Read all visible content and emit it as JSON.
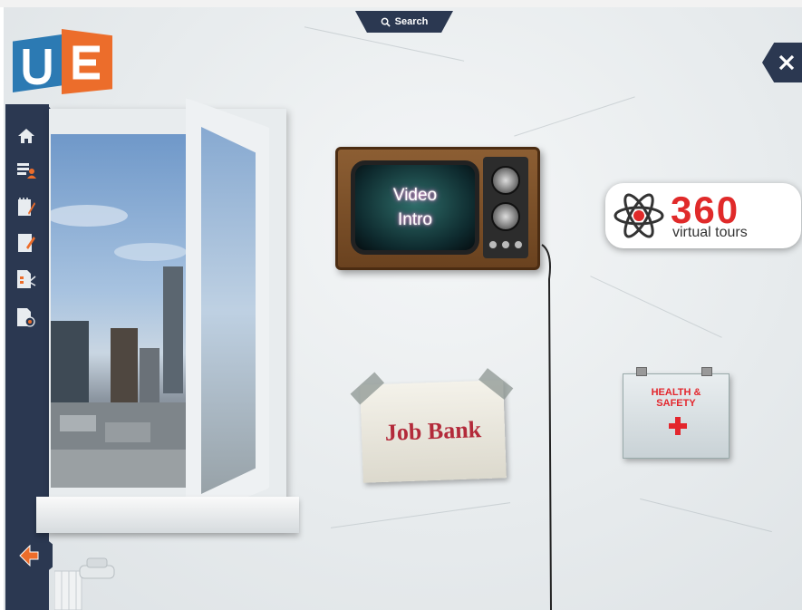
{
  "search": {
    "label": "Search",
    "icon": "search-icon"
  },
  "logo": {
    "text": "UE",
    "colors": {
      "u": "#2c7ab3",
      "e": "#ec6d2b"
    }
  },
  "sidebar": {
    "items": [
      {
        "name": "home",
        "icon": "home-icon"
      },
      {
        "name": "profile-list",
        "icon": "user-list-icon"
      },
      {
        "name": "notes",
        "icon": "notepad-pencil-icon"
      },
      {
        "name": "edit",
        "icon": "document-edit-icon"
      },
      {
        "name": "document-tools",
        "icon": "document-tools-icon"
      },
      {
        "name": "document-target",
        "icon": "document-target-icon"
      }
    ],
    "back_icon": "back-arrow-icon"
  },
  "tv": {
    "line1": "Video",
    "line2": "Intro"
  },
  "tours": {
    "number": "360",
    "subtitle": "virtual tours"
  },
  "job_bank": {
    "label": "Job Bank"
  },
  "health": {
    "line1": "HEALTH &",
    "line2": "SAFETY"
  },
  "close": {
    "icon": "close-icon"
  },
  "colors": {
    "nav": "#2b3851",
    "accent_red": "#e02a2a"
  }
}
